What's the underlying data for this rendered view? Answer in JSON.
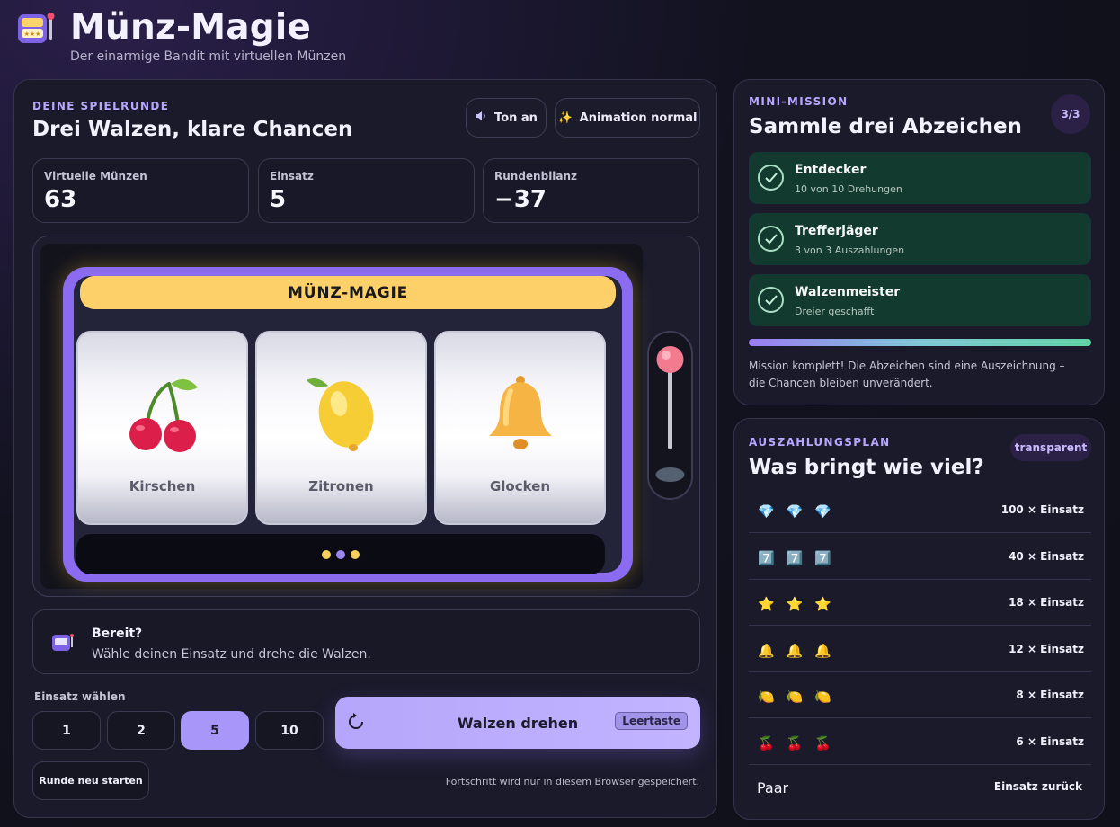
{
  "app": {
    "title": "Münz-Magie",
    "subtitle": "Der einarmige Bandit mit virtuellen Münzen"
  },
  "game": {
    "eyebrow": "DEINE SPIELRUNDE",
    "heading": "Drei Walzen, klare Chancen",
    "sound_label": "Ton an",
    "animation_label": "Animation normal",
    "stats": [
      {
        "label": "Virtuelle Münzen",
        "value": "63"
      },
      {
        "label": "Einsatz",
        "value": "5"
      },
      {
        "label": "Rundenbilanz",
        "value": "−37"
      }
    ],
    "machine_banner": "MÜNZ-MAGIE",
    "reels": [
      {
        "symbol": "cherry-icon",
        "label": "Kirschen"
      },
      {
        "symbol": "lemon-icon",
        "label": "Zitronen"
      },
      {
        "symbol": "bell-icon",
        "label": "Glocken"
      }
    ],
    "indicator_colors": [
      "#f7cf5d",
      "#9b87f0",
      "#f7cf5d"
    ],
    "status_title": "Bereit?",
    "status_text": "Wähle deinen Einsatz und drehe die Walzen.",
    "bet_label": "Einsatz wählen",
    "bets": [
      "1",
      "2",
      "5",
      "10"
    ],
    "selected_bet": "5",
    "spin_label": "Walzen drehen",
    "spin_key": "Leertaste",
    "restart_label": "Runde neu starten",
    "saved_note": "Fortschritt wird nur in diesem Browser gespeichert."
  },
  "mission": {
    "eyebrow": "MINI-MISSION",
    "heading": "Sammle drei Abzeichen",
    "count": "3/3",
    "items": [
      {
        "name": "Entdecker",
        "detail": "10 von 10 Drehungen"
      },
      {
        "name": "Trefferjäger",
        "detail": "3 von 3 Auszahlungen"
      },
      {
        "name": "Walzenmeister",
        "detail": "Dreier geschafft"
      }
    ],
    "progress": 1.0,
    "note": "Mission komplett! Die Abzeichen sind eine Auszeichnung – die Chancen bleiben unverändert."
  },
  "payout": {
    "eyebrow": "AUSZAHLUNGSPLAN",
    "heading": "Was bringt wie viel?",
    "badge": "transparent",
    "rows": [
      {
        "symbols": [
          "💎",
          "💎",
          "💎"
        ],
        "payout": "100 × Einsatz"
      },
      {
        "symbols": [
          "7️⃣",
          "7️⃣",
          "7️⃣"
        ],
        "payout": "40 × Einsatz"
      },
      {
        "symbols": [
          "⭐",
          "⭐",
          "⭐"
        ],
        "payout": "18 × Einsatz"
      },
      {
        "symbols": [
          "🔔",
          "🔔",
          "🔔"
        ],
        "payout": "12 × Einsatz"
      },
      {
        "symbols": [
          "🍋",
          "🍋",
          "🍋"
        ],
        "payout": "8 × Einsatz"
      },
      {
        "symbols": [
          "🍒",
          "🍒",
          "🍒"
        ],
        "payout": "6 × Einsatz"
      }
    ],
    "pair_label": "Paar",
    "pair_payout": "Einsatz zurück"
  }
}
